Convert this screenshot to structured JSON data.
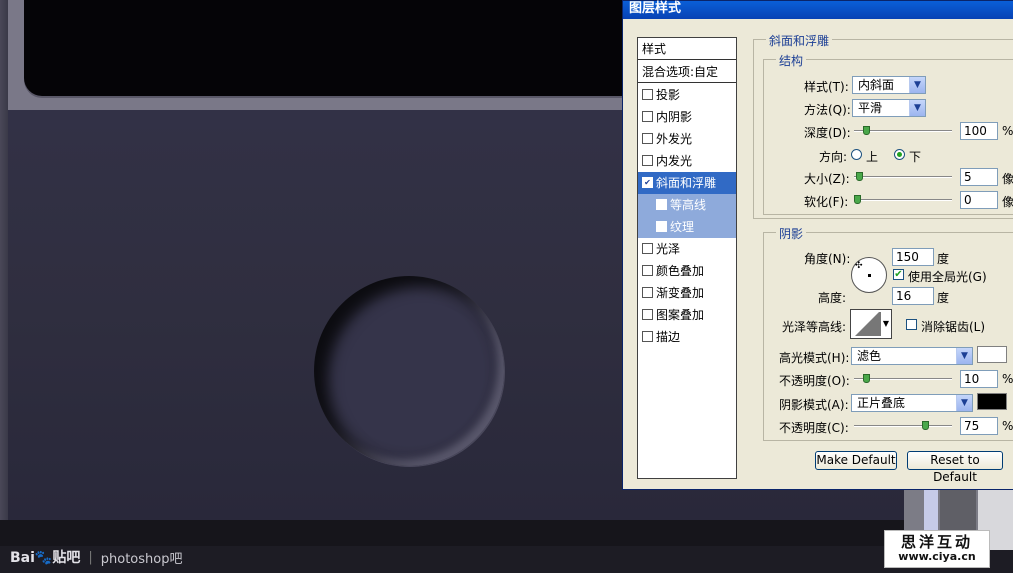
{
  "dialog": {
    "title": "图层样式",
    "styles_header": "样式",
    "blend_options": "混合选项:自定",
    "items": [
      {
        "label": "投影",
        "checked": false
      },
      {
        "label": "内阴影",
        "checked": false
      },
      {
        "label": "外发光",
        "checked": false
      },
      {
        "label": "内发光",
        "checked": false
      },
      {
        "label": "斜面和浮雕",
        "checked": true
      },
      {
        "label": "等高线",
        "checked": false
      },
      {
        "label": "纹理",
        "checked": false
      },
      {
        "label": "光泽",
        "checked": false
      },
      {
        "label": "颜色叠加",
        "checked": false
      },
      {
        "label": "渐变叠加",
        "checked": false
      },
      {
        "label": "图案叠加",
        "checked": false
      },
      {
        "label": "描边",
        "checked": false
      }
    ],
    "bevel": {
      "section_title": "斜面和浮雕",
      "structure_title": "结构",
      "style_label": "样式(T):",
      "style_value": "内斜面",
      "technique_label": "方法(Q):",
      "technique_value": "平滑",
      "depth_label": "深度(D):",
      "depth_value": "100",
      "depth_unit": "%",
      "depth_fraction": 0.1,
      "direction_label": "方向:",
      "direction_up": "上",
      "direction_down": "下",
      "size_label": "大小(Z):",
      "size_value": "5",
      "size_unit": "像",
      "size_fraction": 0.02,
      "soften_label": "软化(F):",
      "soften_value": "0",
      "soften_unit": "像",
      "soften_fraction": 0.0
    },
    "shading": {
      "section_title": "阴影",
      "angle_label": "角度(N):",
      "angle_value": "150",
      "angle_unit": "度",
      "global_light_label": "使用全局光(G)",
      "global_light_checked": true,
      "altitude_label": "高度:",
      "altitude_value": "16",
      "altitude_unit": "度",
      "gloss_contour_label": "光泽等高线:",
      "anti_aliased_label": "消除锯齿(L)",
      "anti_aliased_checked": false,
      "highlight_mode_label": "高光模式(H):",
      "highlight_mode_value": "滤色",
      "highlight_color": "#ffffff",
      "highlight_opacity_label": "不透明度(O):",
      "highlight_opacity_value": "10",
      "highlight_opacity_unit": "%",
      "highlight_opacity_fraction": 0.1,
      "shadow_mode_label": "阴影模式(A):",
      "shadow_mode_value": "正片叠底",
      "shadow_color": "#000000",
      "shadow_opacity_label": "不透明度(C):",
      "shadow_opacity_value": "75",
      "shadow_opacity_unit": "%",
      "shadow_opacity_fraction": 0.75
    },
    "make_default": "Make Default",
    "reset_default": "Reset to Default"
  },
  "watermark": {
    "logo": "Bai🐾贴吧",
    "separator": "|",
    "text": "photoshop吧"
  },
  "site_badge": {
    "name": "思洋互动",
    "url": "www.ciya.cn"
  },
  "colors": {
    "title_bar": "#0a5fd8",
    "selected_item": "#316ac5",
    "section_title": "#1c3f95"
  }
}
